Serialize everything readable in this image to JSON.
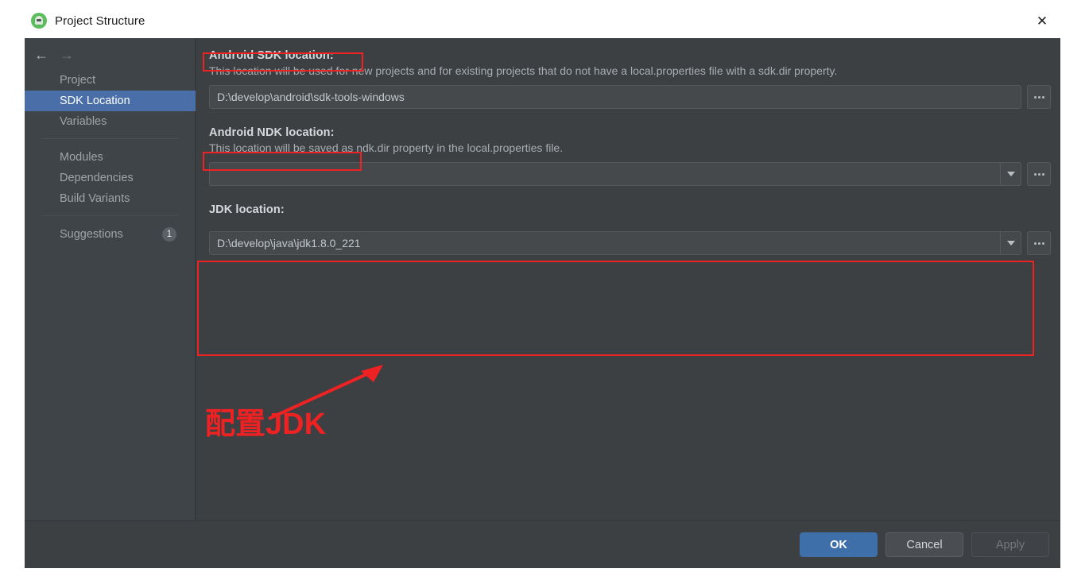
{
  "window": {
    "title": "Project Structure",
    "app_icon": "android-studio-icon",
    "close_label": "✕"
  },
  "nav": {
    "back_icon": "←",
    "forward_icon": "→"
  },
  "sidebar": {
    "items": [
      {
        "label": "Project",
        "selected": false
      },
      {
        "label": "SDK Location",
        "selected": true
      },
      {
        "label": "Variables",
        "selected": false
      },
      {
        "label": "Modules",
        "selected": false
      },
      {
        "label": "Dependencies",
        "selected": false
      },
      {
        "label": "Build Variants",
        "selected": false
      },
      {
        "label": "Suggestions",
        "selected": false,
        "badge": "1"
      }
    ]
  },
  "sections": {
    "sdk": {
      "title": "Android SDK location:",
      "description": "This location will be used for new projects and for existing projects that do not have a local.properties file with a sdk.dir property.",
      "value": "D:\\develop\\android\\sdk-tools-windows",
      "browse_label": "browse-ellipsis"
    },
    "ndk": {
      "title": "Android NDK location:",
      "description": "This location will be saved as ndk.dir property in the local.properties file.",
      "value": "",
      "browse_label": "browse-ellipsis"
    },
    "jdk": {
      "title": "JDK location:",
      "value": "D:\\develop\\java\\jdk1.8.0_221",
      "browse_label": "browse-ellipsis"
    }
  },
  "footer": {
    "ok_label": "OK",
    "cancel_label": "Cancel",
    "apply_label": "Apply"
  },
  "annotations": {
    "callout_text": "配置JDK",
    "accent_color": "#ee2222"
  },
  "theme": {
    "dialog_bg": "#3c4043",
    "sidebar_bg": "#3f4448",
    "selection_blue": "#4a6fa8",
    "primary_button": "#3f6fa8",
    "titlebar_bg": "#ffffff"
  }
}
